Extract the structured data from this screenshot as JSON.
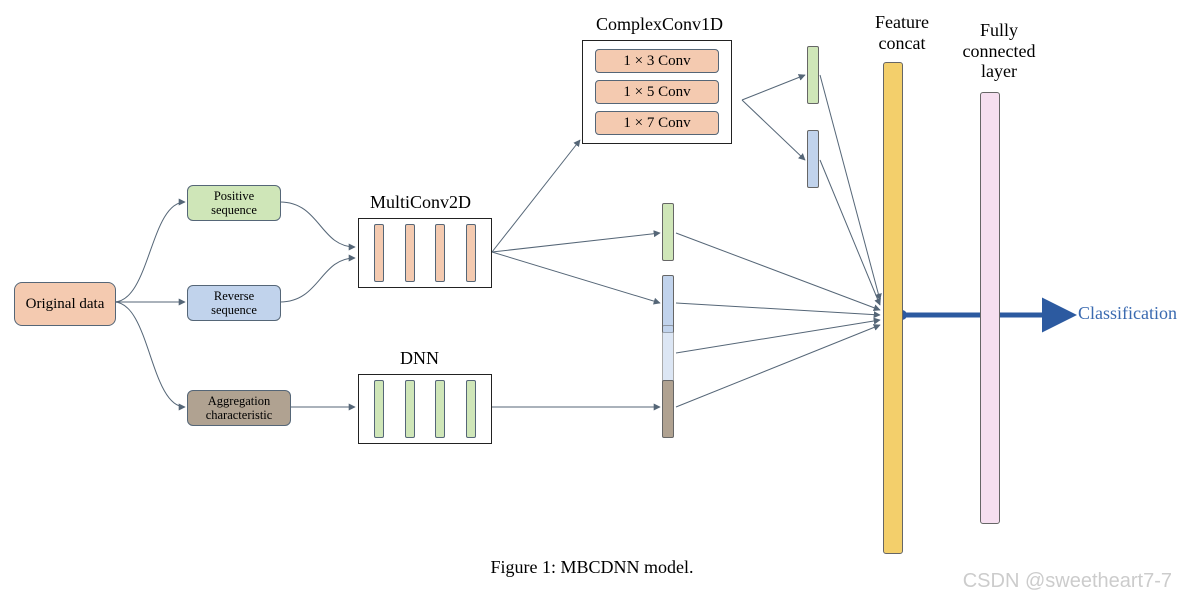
{
  "diagram": {
    "title_caption": "Figure 1: MBCDNN model.",
    "input_node": "Original data",
    "branches": {
      "positive": "Positive\nsequence",
      "reverse": "Reverse\nsequence",
      "aggregation": "Aggregation\ncharacteristic"
    },
    "blocks": {
      "multiconv_label": "MultiConv2D",
      "dnn_label": "DNN",
      "complexconv_label": "ComplexConv1D",
      "feature_concat_label": "Feature\nconcat",
      "fc_label": "Fully\nconnected\nlayer"
    },
    "complex_conv_rows": [
      "1 × 3 Conv",
      "1 × 5 Conv",
      "1 × 7 Conv"
    ],
    "output_label": "Classification",
    "watermark": "CSDN @sweetheart7-7",
    "colors": {
      "orange": "#f4cab0",
      "green": "#cfe6b8",
      "blue": "#c1d3ec",
      "brown": "#b0a291",
      "yellow": "#f3cf6b",
      "pink": "#f6dff0"
    }
  }
}
